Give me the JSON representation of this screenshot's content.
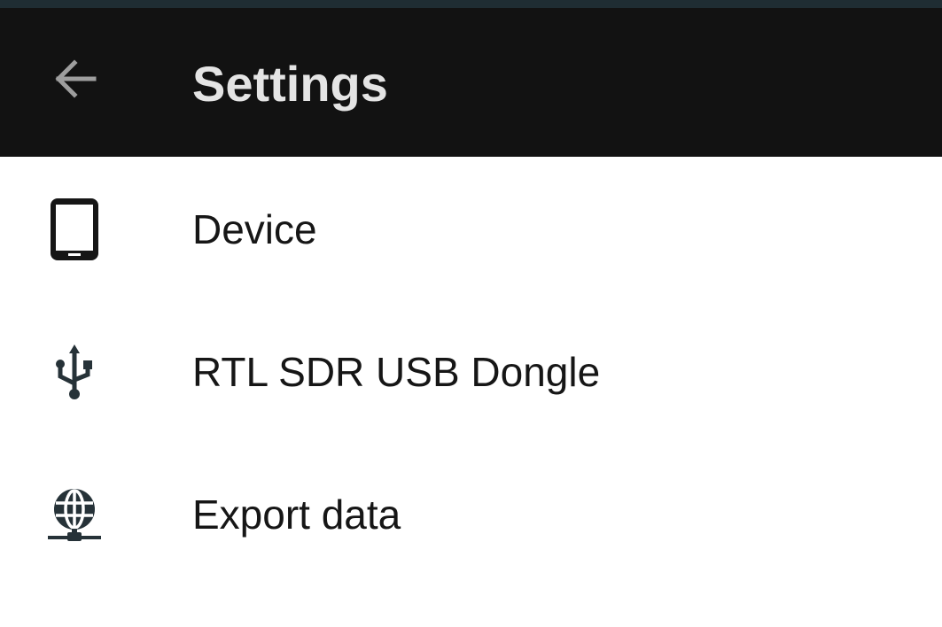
{
  "colors": {
    "status_strip": "#1f2d33",
    "app_bar": "#121212",
    "title_text": "#e4e4e4",
    "item_text": "#161616",
    "icon": "#1f2d33"
  },
  "app_bar": {
    "back_icon": "arrow-left-icon",
    "title": "Settings"
  },
  "settings": {
    "items": [
      {
        "icon": "tablet-icon",
        "label": "Device"
      },
      {
        "icon": "usb-icon",
        "label": "RTL SDR USB Dongle"
      },
      {
        "icon": "globe-network-icon",
        "label": "Export data"
      }
    ]
  }
}
